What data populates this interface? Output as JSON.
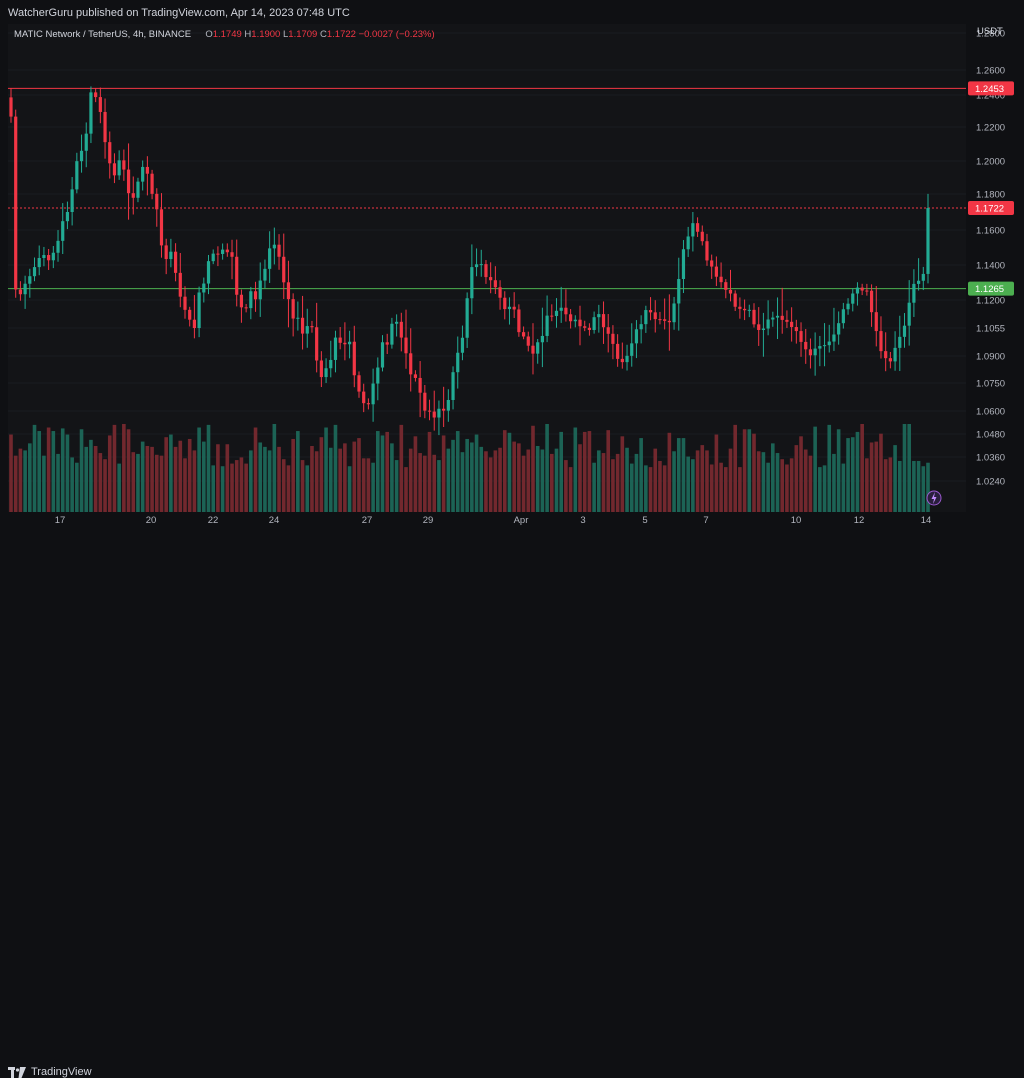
{
  "header": {
    "published": "WatcherGuru published on TradingView.com, Apr 14, 2023 07:48 UTC"
  },
  "legend": {
    "symbol": "MATIC Network / TetherUS, 4h, BINANCE",
    "o_label": "O",
    "o_value": "1.1749",
    "h_label": "H",
    "h_value": "1.1900",
    "l_label": "L",
    "l_value": "1.1709",
    "c_label": "C",
    "c_value": "1.1722",
    "change": "−0.0027 (−0.23%)"
  },
  "currency": "USDT",
  "footer": {
    "brand": "TradingView",
    "logo_icon": "tradingview-logo-icon"
  },
  "colors": {
    "up": "#22ab94",
    "down": "#f23645",
    "support": "#4caf50",
    "resistance": "#f23645"
  },
  "chart_data": {
    "type": "candlestick",
    "symbol": "MATIC Network / TetherUS",
    "interval": "4h",
    "exchange": "BINANCE",
    "y_ticks": [
      "1.2800",
      "1.2600",
      "1.2400",
      "1.2200",
      "1.2000",
      "1.1800",
      "1.1600",
      "1.1400",
      "1.1200",
      "1.1055",
      "1.0900",
      "1.0750",
      "1.0600",
      "1.0480",
      "1.0360",
      "1.0240"
    ],
    "x_ticks": [
      "17",
      "20",
      "22",
      "24",
      "27",
      "29",
      "Apr",
      "3",
      "5",
      "7",
      "10",
      "12",
      "14"
    ],
    "horizontal_lines": [
      {
        "value": 1.2453,
        "label": "1.2453",
        "color": "#f23645",
        "style": "solid"
      },
      {
        "value": 1.1265,
        "label": "1.1265",
        "color": "#4caf50",
        "style": "solid"
      },
      {
        "value": 1.1722,
        "label": "1.1722",
        "color": "#f23645",
        "style": "dotted"
      }
    ],
    "close_series": [
      1.2265,
      1.126,
      1.1233,
      1.1293,
      1.1336,
      1.1388,
      1.144,
      1.1457,
      1.1427,
      1.147,
      1.1538,
      1.1649,
      1.17,
      1.1828,
      1.1999,
      1.206,
      1.2161,
      1.2421,
      1.2387,
      1.2294,
      1.2111,
      1.1986,
      1.1913,
      1.2004,
      1.1948,
      1.1805,
      1.1779,
      1.1875,
      1.1964,
      1.1923,
      1.1801,
      1.1715,
      1.1512,
      1.1434,
      1.1476,
      1.1355,
      1.1219,
      1.1149,
      1.1098,
      1.1055,
      1.1243,
      1.1294,
      1.1422,
      1.1465,
      1.1463,
      1.1488,
      1.1473,
      1.1447,
      1.123,
      1.1162,
      1.1158,
      1.125,
      1.1204,
      1.1311,
      1.1378,
      1.1495,
      1.1516,
      1.1447,
      1.1301,
      1.1205,
      1.1104,
      1.1108,
      1.1024,
      1.1065,
      1.1059,
      1.0875,
      1.0783,
      1.0832,
      1.0878,
      1.1002,
      1.0973,
      1.0965,
      1.0979,
      1.0793,
      1.0704,
      1.0642,
      1.0636,
      1.0747,
      1.0836,
      1.0976,
      1.0963,
      1.1077,
      1.1087,
      1.1002,
      1.0915,
      1.0798,
      1.0778,
      1.0698,
      1.0602,
      1.0597,
      1.0566,
      1.0612,
      1.0602,
      1.0659,
      1.081,
      1.0918,
      1.1001,
      1.121,
      1.1388,
      1.1404,
      1.1405,
      1.1331,
      1.1313,
      1.1273,
      1.1213,
      1.1153,
      1.1165,
      1.1151,
      1.1032,
      1.1008,
      1.0957,
      1.0913,
      1.0976,
      1.1011,
      1.1119,
      1.1117,
      1.1144,
      1.116,
      1.1126,
      1.109,
      1.1098,
      1.1064,
      1.1056,
      1.1044,
      1.1111,
      1.1127,
      1.1059,
      1.1023,
      1.0967,
      1.0884,
      1.0866,
      1.0901,
      1.097,
      1.1048,
      1.1075,
      1.1148,
      1.1136,
      1.1101,
      1.11,
      1.1092,
      1.1085,
      1.1182,
      1.132,
      1.149,
      1.1563,
      1.1638,
      1.159,
      1.1536,
      1.1426,
      1.1391,
      1.1333,
      1.1302,
      1.1258,
      1.1237,
      1.1165,
      1.1154,
      1.1147,
      1.1149,
      1.1074,
      1.1044,
      1.1052,
      1.1099,
      1.1109,
      1.1118,
      1.1097,
      1.1087,
      1.106,
      1.1038,
      1.0978,
      1.0937,
      1.0904,
      1.0941,
      1.0955,
      1.096,
      1.098,
      1.1019,
      1.108,
      1.1152,
      1.1181,
      1.1237,
      1.1271,
      1.1254,
      1.1253,
      1.1137,
      1.1038,
      1.0927,
      1.0888,
      1.087,
      1.0945,
      1.1006,
      1.1067,
      1.1186,
      1.1292,
      1.131,
      1.1349,
      1.1722
    ],
    "volume_series": [
      88,
      64,
      72,
      70,
      78,
      99,
      92,
      64,
      96,
      92,
      66,
      95,
      88,
      62,
      56,
      94,
      74,
      82,
      75,
      67,
      60,
      87,
      99,
      55,
      100,
      94,
      68,
      66,
      80,
      75,
      74,
      65,
      64,
      85,
      88,
      74,
      81,
      61,
      83,
      70,
      96,
      80,
      99,
      53,
      77,
      52,
      77,
      55,
      59,
      62,
      55,
      70,
      96,
      79,
      74,
      70,
      100,
      74,
      60,
      53,
      83,
      92,
      59,
      53,
      75,
      69,
      85,
      96,
      73,
      99,
      72,
      78,
      52,
      80,
      84,
      61,
      61,
      56,
      92,
      87,
      91,
      78,
      59,
      99,
      51,
      72,
      86,
      67,
      64,
      91,
      65,
      59,
      87,
      72,
      82,
      92,
      68,
      83,
      79,
      88,
      74,
      69,
      62,
      70,
      73,
      93,
      90,
      80,
      78,
      64,
      71,
      98,
      75,
      71,
      100,
      66,
      72,
      91,
      59,
      51,
      96,
      77,
      91,
      92,
      56,
      70,
      67,
      93,
      60,
      66,
      86,
      73,
      55,
      66,
      84,
      53,
      51,
      72,
      58,
      53,
      90,
      69,
      84,
      84,
      63,
      60,
      70,
      76,
      70,
      54,
      88,
      56,
      51,
      72,
      99,
      51,
      94,
      94,
      89,
      69,
      68,
      56,
      78,
      67,
      60,
      54,
      61,
      76,
      86,
      71,
      64,
      97,
      51,
      53,
      99,
      66,
      94,
      55,
      84,
      85,
      91,
      100,
      61,
      79,
      80,
      89,
      60,
      62,
      76,
      58,
      100,
      100,
      58,
      58,
      52,
      56,
      63,
      70,
      96,
      57
    ]
  }
}
